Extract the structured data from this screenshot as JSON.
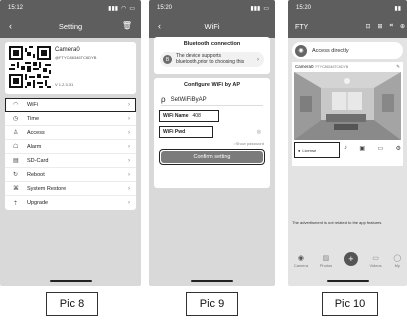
{
  "pic8": {
    "time": "15:12",
    "title": "Setting",
    "camera": {
      "name": "Camera0",
      "uid": "@FTYC86346TC6DYB",
      "version": "V 1.2.3.31"
    },
    "menu": [
      {
        "label": "WiFi",
        "icon": "wifi-icon"
      },
      {
        "label": "Time",
        "icon": "clock-icon"
      },
      {
        "label": "Access",
        "icon": "person-icon"
      },
      {
        "label": "Alarm",
        "icon": "alarm-icon"
      },
      {
        "label": "SD-Card",
        "icon": "sdcard-icon"
      },
      {
        "label": "Reboot",
        "icon": "reboot-icon"
      },
      {
        "label": "System Restore",
        "icon": "restore-icon"
      },
      {
        "label": "Upgrade",
        "icon": "upgrade-icon"
      }
    ],
    "highlighted_item": "WiFi",
    "caption": "Pic 8"
  },
  "pic9": {
    "time": "15:20",
    "title": "WiFi",
    "bluetooth": {
      "title": "Bluetooth connection",
      "text": "The device supports bluetooth,prior to choosing this",
      "badge": "B"
    },
    "wifi_config": {
      "title": "Configure WiFi by AP",
      "ssid": "SetWiFiByAP",
      "name_label": "WiFi Name",
      "name_value": "408",
      "pwd_label": "WiFi Pwd",
      "show_password": "Show password",
      "confirm": "Confirm setting"
    },
    "caption": "Pic 9"
  },
  "pic10": {
    "time": "15:20",
    "app_name": "FTY",
    "access": "Access directly",
    "camera_name": "Camera0",
    "camera_uid": "FTYC86346TC6DYB",
    "license": "License",
    "ad_text": "The advertisment is not related to the app features",
    "tabs": [
      {
        "label": "Camera",
        "icon": "camera-tab-icon",
        "active": true
      },
      {
        "label": "Photos",
        "icon": "photos-tab-icon",
        "active": false
      },
      {
        "label": "",
        "icon": "plus-icon",
        "active": false
      },
      {
        "label": "Videos",
        "icon": "videos-tab-icon",
        "active": false
      },
      {
        "label": "My",
        "icon": "my-tab-icon",
        "active": false
      }
    ],
    "caption": "Pic 10"
  }
}
